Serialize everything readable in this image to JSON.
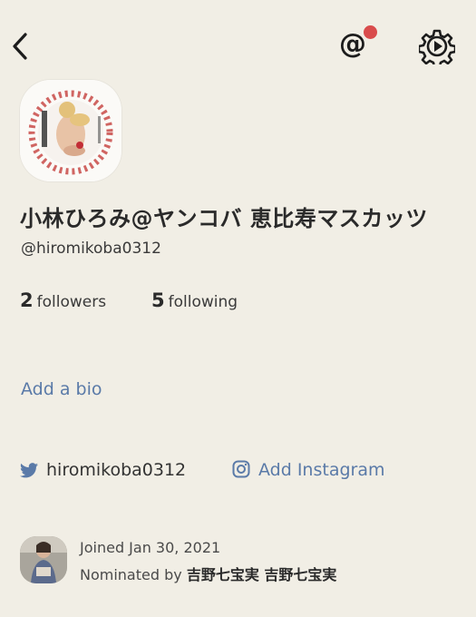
{
  "profile": {
    "display_name": "小林ひろみ@ヤンコバ 恵比寿マスカッツ",
    "username": "@hiromikoba0312",
    "followers_count": "2",
    "followers_label": "followers",
    "following_count": "5",
    "following_label": "following",
    "bio_link": "Add a bio",
    "twitter_handle": "hiromikoba0312",
    "instagram_link": "Add Instagram",
    "joined": "Joined Jan 30, 2021",
    "nominated_prefix": "Nominated by ",
    "nominator_name": "吉野七宝実 吉野七宝実"
  },
  "header": {
    "back_icon": "chevron-left-icon",
    "mention_symbol": "@",
    "mention_icon": "at-sign-icon",
    "settings_icon": "gear-icon",
    "notification_dot_color": "#d94c4c"
  },
  "colors": {
    "background": "#f1eee5",
    "link": "#5a7aa8",
    "text": "#2b2b2b"
  }
}
